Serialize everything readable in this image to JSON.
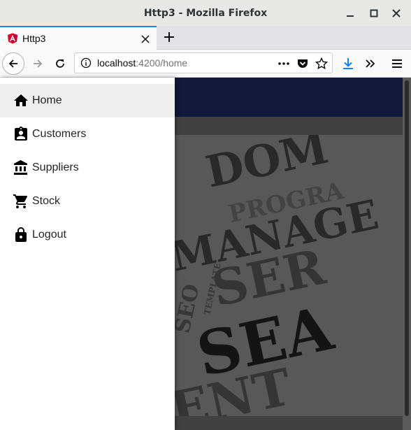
{
  "window": {
    "title": "Http3 - Mozilla Firefox"
  },
  "tab": {
    "label": "Http3"
  },
  "url": {
    "host": "localhost",
    "rest": ":4200/home"
  },
  "sidenav": {
    "items": [
      {
        "label": "Home",
        "icon": "home-icon",
        "active": true
      },
      {
        "label": "Customers",
        "icon": "contact-badge-icon",
        "active": false
      },
      {
        "label": "Suppliers",
        "icon": "bank-icon",
        "active": false
      },
      {
        "label": "Stock",
        "icon": "shopping-cart-icon",
        "active": false
      },
      {
        "label": "Logout",
        "icon": "lock-icon",
        "active": false
      }
    ]
  },
  "hero": {
    "words": [
      "DOM",
      "PROGRA",
      "MANAGE",
      "SER",
      "SEO",
      "TEMPLATE",
      "SEA",
      "ENT"
    ]
  },
  "colors": {
    "toolbar": "#1a2250",
    "active_tab_accent": "#0a84ff",
    "download_icon": "#0a84ff"
  }
}
